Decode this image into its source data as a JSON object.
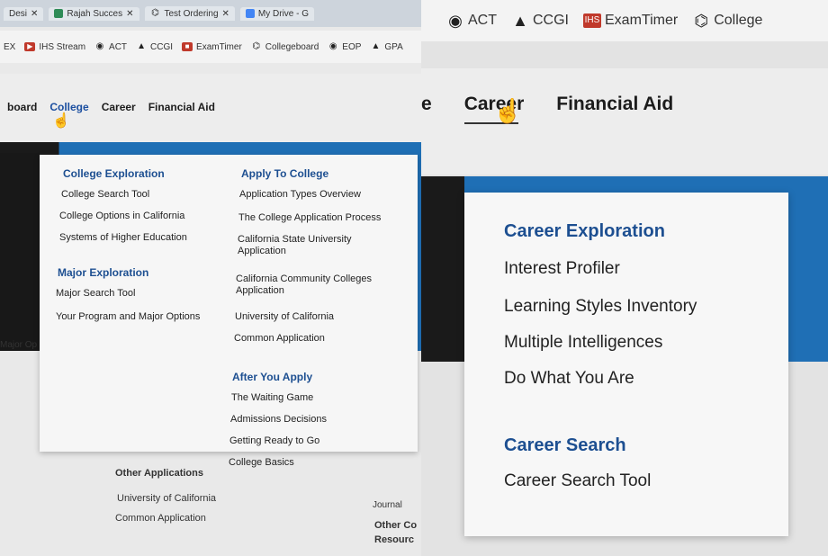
{
  "left": {
    "tabs": [
      {
        "label": "Desi",
        "favicon": "page-icon"
      },
      {
        "label": "Rajah Succes",
        "favicon": "docs-icon"
      },
      {
        "label": "Test Ordering",
        "favicon": "acorn-icon"
      },
      {
        "label": "My Drive - G",
        "favicon": "drive-icon"
      }
    ],
    "bookmarks": [
      {
        "label": "EX",
        "icon": "none"
      },
      {
        "label": "IHS Stream",
        "icon": "stream-icon"
      },
      {
        "label": "ACT",
        "icon": "globe-icon"
      },
      {
        "label": "CCGI",
        "icon": "graduation-cap-icon"
      },
      {
        "label": "ExamTimer",
        "icon": "ihs-icon"
      },
      {
        "label": "Collegeboard",
        "icon": "acorn-icon"
      },
      {
        "label": "EOP",
        "icon": "globe-icon"
      },
      {
        "label": "GPA",
        "icon": "graduation-cap-icon"
      }
    ],
    "nav": {
      "items": [
        "board",
        "College",
        "Career",
        "Financial Aid"
      ],
      "active": "College"
    },
    "side_text": "Major Op",
    "dropdown": {
      "col1": [
        {
          "heading": "College Exploration",
          "items": [
            "College Search Tool",
            "College Options in California",
            "Systems of Higher Education"
          ]
        },
        {
          "heading": "Major Exploration",
          "items": [
            "Major Search Tool",
            "Your Program and Major Options"
          ]
        }
      ],
      "col2": [
        {
          "heading": "Apply To College",
          "items": [
            "Application Types Overview",
            "The College Application Process",
            "California State University Application",
            "California Community Colleges Application",
            "University of California",
            "Common Application"
          ]
        },
        {
          "heading": "After You Apply",
          "items": [
            "The Waiting Game",
            "Admissions Decisions",
            "Getting Ready to Go",
            "College Basics"
          ]
        }
      ]
    },
    "below": {
      "heading": "Other Applications",
      "items": [
        "University of California",
        "Common Application"
      ],
      "right_text": "Journal",
      "right_heading": [
        "Other Co",
        "Resourc"
      ]
    }
  },
  "right": {
    "bookmarks": [
      {
        "label": "ACT",
        "icon": "globe-icon"
      },
      {
        "label": "CCGI",
        "icon": "graduation-cap-icon"
      },
      {
        "label": "ExamTimer",
        "icon": "ihs-icon"
      },
      {
        "label": "College",
        "icon": "acorn-icon"
      }
    ],
    "nav": {
      "items": [
        "e",
        "Career",
        "Financial Aid"
      ],
      "active": "Career"
    },
    "dropdown": {
      "sections": [
        {
          "heading": "Career Exploration",
          "items": [
            "Interest Profiler",
            "Learning Styles Inventory",
            "Multiple Intelligences",
            "Do What You Are"
          ]
        },
        {
          "heading": "Career Search",
          "items": [
            "Career Search Tool"
          ]
        }
      ]
    }
  },
  "colors": {
    "accent": "#1d4f91",
    "hero_blue": "#1f6fb5"
  }
}
